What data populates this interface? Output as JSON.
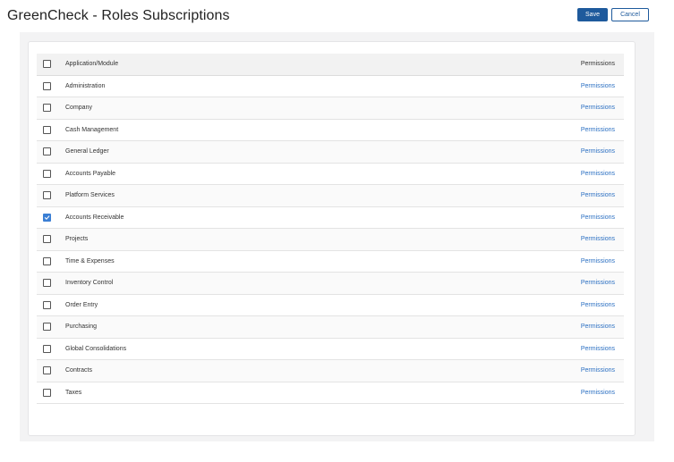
{
  "header": {
    "title": "GreenCheck - Roles Subscriptions",
    "save_label": "Save",
    "cancel_label": "Cancel"
  },
  "table": {
    "col_module": "Application/Module",
    "col_permissions": "Permissions",
    "rows": [
      {
        "name": "Administration",
        "checked": false,
        "link": "Permissions"
      },
      {
        "name": "Company",
        "checked": false,
        "link": "Permissions"
      },
      {
        "name": "Cash Management",
        "checked": false,
        "link": "Permissions"
      },
      {
        "name": "General Ledger",
        "checked": false,
        "link": "Permissions"
      },
      {
        "name": "Accounts Payable",
        "checked": false,
        "link": "Permissions"
      },
      {
        "name": "Platform Services",
        "checked": false,
        "link": "Permissions"
      },
      {
        "name": "Accounts Receivable",
        "checked": true,
        "link": "Permissions"
      },
      {
        "name": "Projects",
        "checked": false,
        "link": "Permissions"
      },
      {
        "name": "Time & Expenses",
        "checked": false,
        "link": "Permissions"
      },
      {
        "name": "Inventory Control",
        "checked": false,
        "link": "Permissions"
      },
      {
        "name": "Order Entry",
        "checked": false,
        "link": "Permissions"
      },
      {
        "name": "Purchasing",
        "checked": false,
        "link": "Permissions"
      },
      {
        "name": "Global Consolidations",
        "checked": false,
        "link": "Permissions"
      },
      {
        "name": "Contracts",
        "checked": false,
        "link": "Permissions"
      },
      {
        "name": "Taxes",
        "checked": false,
        "link": "Permissions"
      }
    ]
  },
  "colors": {
    "primary": "#1e5a9c",
    "link": "#2a6fc2",
    "checkbox_checked": "#3b7fd4"
  }
}
